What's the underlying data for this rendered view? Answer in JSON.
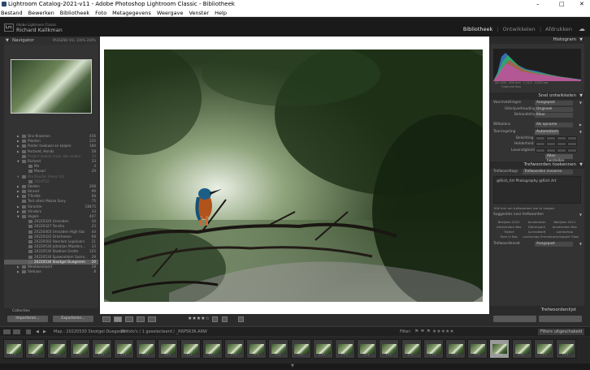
{
  "window": {
    "title": "Lightroom Catalog-2021-v11 - Adobe Photoshop Lightroom Classic - Bibliotheek",
    "minimize": "–",
    "maximize": "□",
    "close": "✕"
  },
  "menu": [
    "Bestand",
    "Bewerken",
    "Bibliotheek",
    "Foto",
    "Metagegevens",
    "Weergave",
    "Venster",
    "Help"
  ],
  "identity": {
    "logo": "Lrc",
    "product": "Adobe Lightroom Classic",
    "user": "Richard Kallkman"
  },
  "modules": {
    "library": "Bibliotheek",
    "develop": "Ontwikkelen",
    "print": "Afdrukken",
    "sep": "|",
    "cloud_icon": "cloud-icon"
  },
  "navigator": {
    "title": "Navigator",
    "zoom": "PASSEND   VUL   100%   200%"
  },
  "folders": [
    {
      "name": "Ons Knoenen",
      "count": "456",
      "tri": "▶"
    },
    {
      "name": "Planten",
      "count": "235",
      "tri": "▶"
    },
    {
      "name": "Polder hoekwal en kolpen",
      "count": "180",
      "tri": "▶"
    },
    {
      "name": "Portaret, Honds",
      "count": "58",
      "tri": "▶"
    },
    {
      "name": "Project dewod maar den enden",
      "count": "29",
      "tri": "",
      "dim": true
    },
    {
      "name": "Richard",
      "count": "33",
      "tri": "▼"
    },
    {
      "name": "Me",
      "count": "4",
      "tri": "",
      "indent": true
    },
    {
      "name": "Maaarl",
      "count": "29",
      "tri": "",
      "indent": true
    },
    {
      "name": "Ola Rouder Unwis Ulz",
      "count": "",
      "tri": "▼",
      "dim": true
    },
    {
      "name": "2019T02",
      "count": "",
      "tri": "",
      "indent": true,
      "dim": true
    },
    {
      "name": "Steden",
      "count": "208",
      "tri": "▶"
    },
    {
      "name": "Strand",
      "count": "99",
      "tri": "▶"
    },
    {
      "name": "T-Tertilk",
      "count": "68",
      "tri": "▶"
    },
    {
      "name": "Test vitels Mezze Sony",
      "count": "75",
      "tri": ""
    },
    {
      "name": "Varantie",
      "count": "18475",
      "tri": "▶"
    },
    {
      "name": "Vlinders",
      "count": "33",
      "tri": "▶"
    },
    {
      "name": "Vogels",
      "count": "407",
      "tri": "▼"
    },
    {
      "name": "20220320 Urnsaden",
      "count": "34",
      "tri": "",
      "indent": true
    },
    {
      "name": "20220327 Tersilia",
      "count": "23",
      "tri": "",
      "indent": true
    },
    {
      "name": "20220403 Urnsaden High Vaz",
      "count": "44",
      "tri": "",
      "indent": true
    },
    {
      "name": "20220422 Ornehoeen",
      "count": "68",
      "tri": "",
      "indent": true
    },
    {
      "name": "20220502 Haerlam Lopeluars",
      "count": "21",
      "tri": "",
      "indent": true
    },
    {
      "name": "20220530 Jutlatijas Maarbru...",
      "count": "33",
      "tri": "",
      "indent": true
    },
    {
      "name": "20220530 Stadlam Grotte",
      "count": "125",
      "tri": "",
      "indent": true
    },
    {
      "name": "20220530 Spawroldem Saara...",
      "count": "28",
      "tri": "",
      "indent": true
    },
    {
      "name": "20220530 Slootgel  Duegerem",
      "count": "20",
      "tri": "",
      "indent": true,
      "sel": true
    },
    {
      "name": "Weekbenkaart",
      "count": "28",
      "tri": "▶"
    },
    {
      "name": "Stekaan",
      "count": "8",
      "tri": "▶"
    }
  ],
  "folders_footer": "Collecties",
  "left_buttons": {
    "import": "Importeren...",
    "export": "Exporteren..."
  },
  "toolbar": {
    "stars": "★★★★☆",
    "grid_icon": "grid-view-icon",
    "loupe_icon": "loupe-view-icon",
    "compare_icon": "compare-view-icon",
    "survey_icon": "survey-view-icon",
    "people_icon": "people-view-icon",
    "rotate_left_icon": "rotate-left-icon",
    "rotate_right_icon": "rotate-right-icon",
    "painter_icon": "painter-icon"
  },
  "histogram": {
    "title": "Histogram",
    "info_left": "ISO 400",
    "info_mid1": "400 mm",
    "info_mid2": "f / 6,3",
    "info_right": "1/320 sec",
    "original": "Originele foto"
  },
  "quick_develop": {
    "title": "Snel ontwikkelen",
    "preset_label": "Voorinstellingen",
    "preset_value": "Aangepast",
    "crop_label": "Uitsnijverhouding",
    "crop_value": "Origineel",
    "treatment_label": "Behandeling",
    "treatment_value": "Kleur",
    "wb_label": "Witbalans",
    "wb_value": "Als opname",
    "tone_label": "Toonregeling",
    "tone_auto": "Automatisch",
    "exposure_label": "Belichting",
    "clarity_label": "Helderheid",
    "vibrance_label": "Levendigheid",
    "reset_label": "Alles herstellen"
  },
  "keywording": {
    "title": "Trefwoorden toekennen",
    "tags_label": "Trefwoordtags",
    "tags_value": "Trefwoorden invoeren",
    "text": "@Rich_Art Photography @Rich Art",
    "hint": "Klik hier om trefwoorden toe te voegen",
    "suggest_title": "Suggesties voor trefwoorden",
    "suggestions": [
      "Bekijken 2022",
      "Amsterdam",
      "Bekijken 2021",
      "Amsterdam Bos",
      "Dierenpark",
      "Amsterdam Bos",
      "Traject",
      "Lycrasbladt",
      "Landschap",
      "Toen in Bos",
      "Landschap Emmen",
      "Lanschapper Slaag"
    ],
    "set_label": "Trefwoordenset",
    "set_value": "Aangepast"
  },
  "keyword_list_title": "Trefwoordenlijst",
  "filmbar": {
    "page1": "1",
    "page2": "2",
    "path": "Map : 20220530 Slootgel  Duegerem",
    "count": "20 foto's / 1 geselecteerd / _R6P5636.ARW",
    "filter_label": "Filter:",
    "filter_value": "Filters uitgeschakeld"
  },
  "filmstrip_count": 26,
  "filmstrip_current": 22,
  "colors": {
    "panel_bg": "#333333",
    "frame_bg": "#2b2b2b",
    "accent_text": "#e8e8e8",
    "selected_row": "#5b5b5b"
  }
}
